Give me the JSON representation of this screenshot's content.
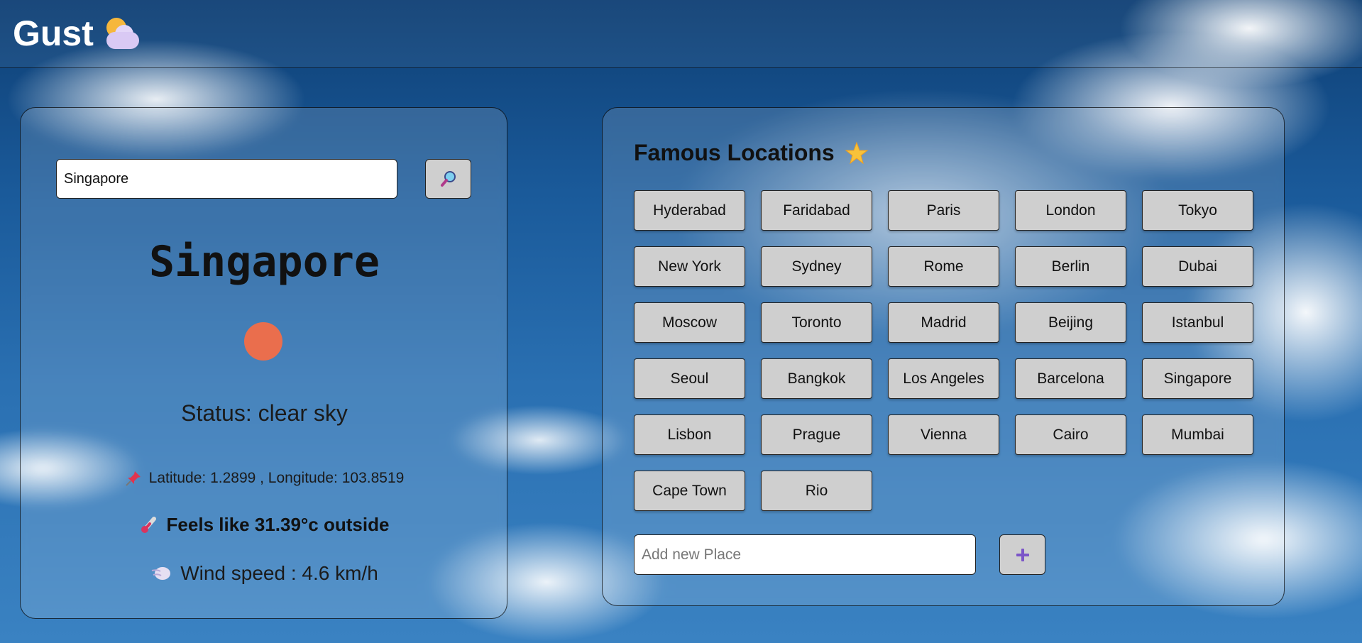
{
  "header": {
    "title": "Gust",
    "logo_icon": "sun-behind-cloud-icon"
  },
  "search": {
    "value": "Singapore",
    "button_icon": "magnifier-icon"
  },
  "weather": {
    "city": "Singapore",
    "condition_icon": "sun-icon",
    "condition_color": "#ea6e4d",
    "status": "Status: clear sky",
    "coordinates": "Latitude: 1.2899 , Longitude: 103.8519",
    "coordinates_icon": "pushpin-icon",
    "feels_like": "Feels like 31.39°c outside",
    "feels_like_icon": "thermometer-icon",
    "wind": "Wind speed : 4.6 km/h",
    "wind_icon": "wind-icon"
  },
  "famous": {
    "title": "Famous Locations",
    "title_icon": "glowing-star-icon",
    "locations": [
      "Hyderabad",
      "Faridabad",
      "Paris",
      "London",
      "Tokyo",
      "New York",
      "Sydney",
      "Rome",
      "Berlin",
      "Dubai",
      "Moscow",
      "Toronto",
      "Madrid",
      "Beijing",
      "Istanbul",
      "Seoul",
      "Bangkok",
      "Los Angeles",
      "Barcelona",
      "Singapore",
      "Lisbon",
      "Prague",
      "Vienna",
      "Cairo",
      "Mumbai",
      "Cape Town",
      "Rio"
    ],
    "add_placeholder": "Add new Place",
    "add_icon": "plus-icon"
  }
}
